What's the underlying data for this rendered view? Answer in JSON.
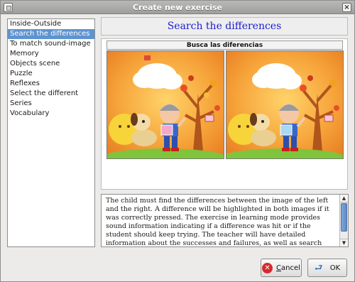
{
  "window": {
    "title": "Create new exercise",
    "close_symbol": "×"
  },
  "exercise_list": {
    "items": [
      "Inside-Outside",
      "Search the differences",
      "To match sound-image",
      "Memory",
      "Objects scene",
      "Puzzle",
      "Reflexes",
      "Select the different",
      "Series",
      "Vocabulary"
    ],
    "selected_index": 1
  },
  "header": {
    "title": "Search the differences"
  },
  "preview": {
    "caption": "Busca las diferencias"
  },
  "description": {
    "text": "The child must find the differences between the image of the left and the right. A difference will be highlighted in both images if it was correctly pressed. The exercise in learning mode provides sound information indicating if a difference was hit or if the student should keep trying. The teacher will have detailed information about the successes and failures, as well as search strategies followed by"
  },
  "buttons": {
    "cancel": {
      "first_letter": "C",
      "rest": "ancel"
    },
    "ok": "OK"
  },
  "colors": {
    "selection": "#5e93d0",
    "header_title": "#1c1ccf"
  }
}
